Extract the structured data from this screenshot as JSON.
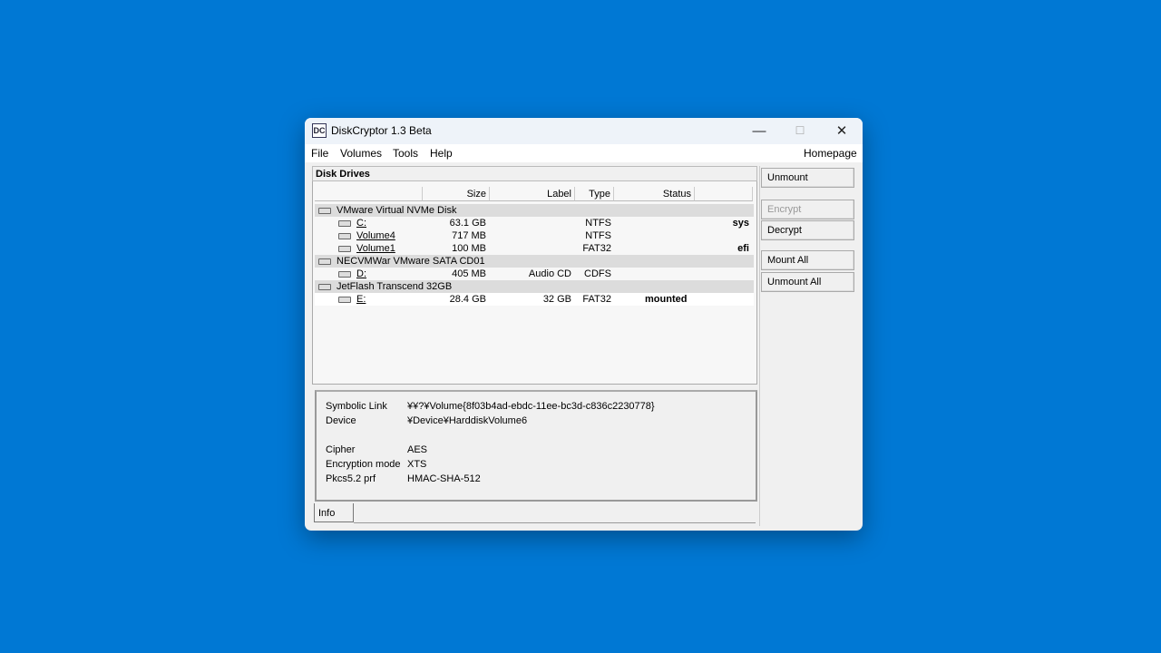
{
  "window": {
    "title": "DiskCryptor 1.3 Beta",
    "logo": "DC",
    "minimize": "—",
    "maximize": "☐",
    "close": "✕"
  },
  "menu": {
    "items": [
      "File",
      "Volumes",
      "Tools",
      "Help"
    ],
    "homepage": "Homepage"
  },
  "drives": {
    "title": "Disk Drives",
    "columns": [
      "",
      "Size",
      "Label",
      "Type",
      "Status",
      ""
    ],
    "rows": [
      {
        "kind": "disk",
        "name": "VMware Virtual NVMe Disk",
        "size": "",
        "label": "",
        "type": "",
        "status": "",
        "flag": ""
      },
      {
        "kind": "vol",
        "name": "C:",
        "size": "63.1 GB",
        "label": "",
        "type": "NTFS",
        "status": "",
        "flag": "sys"
      },
      {
        "kind": "vol",
        "name": "Volume4",
        "size": "717 MB",
        "label": "",
        "type": "NTFS",
        "status": "",
        "flag": ""
      },
      {
        "kind": "vol",
        "name": "Volume1",
        "size": "100 MB",
        "label": "",
        "type": "FAT32",
        "status": "",
        "flag": "efi"
      },
      {
        "kind": "disk",
        "name": "NECVMWar VMware SATA CD01",
        "size": "",
        "label": "",
        "type": "",
        "status": "",
        "flag": ""
      },
      {
        "kind": "cd",
        "name": "D:",
        "size": "405 MB",
        "label": "Audio CD",
        "type": "CDFS",
        "status": "",
        "flag": ""
      },
      {
        "kind": "disk",
        "name": "JetFlash Transcend 32GB",
        "size": "",
        "label": "",
        "type": "",
        "status": "",
        "flag": ""
      },
      {
        "kind": "sel",
        "name": "E:",
        "size": "28.4 GB",
        "label": "32 GB",
        "type": "FAT32",
        "status": "mounted",
        "flag": ""
      }
    ]
  },
  "info": {
    "fields": [
      {
        "label": "Symbolic Link",
        "value": "¥¥?¥Volume{8f03b4ad-ebdc-11ee-bc3d-c836c2230778}"
      },
      {
        "label": "Device",
        "value": "¥Device¥HarddiskVolume6"
      },
      {
        "label": "Cipher",
        "value": "AES"
      },
      {
        "label": "Encryption mode",
        "value": "XTS"
      },
      {
        "label": "Pkcs5.2 prf",
        "value": "HMAC-SHA-512"
      }
    ],
    "tab": "Info"
  },
  "buttons": [
    {
      "label": "Unmount",
      "enabled": true
    },
    {
      "label": "Encrypt",
      "enabled": false
    },
    {
      "label": "Decrypt",
      "enabled": true
    },
    {
      "label": "Mount All",
      "enabled": true
    },
    {
      "label": "Unmount All",
      "enabled": true
    }
  ]
}
